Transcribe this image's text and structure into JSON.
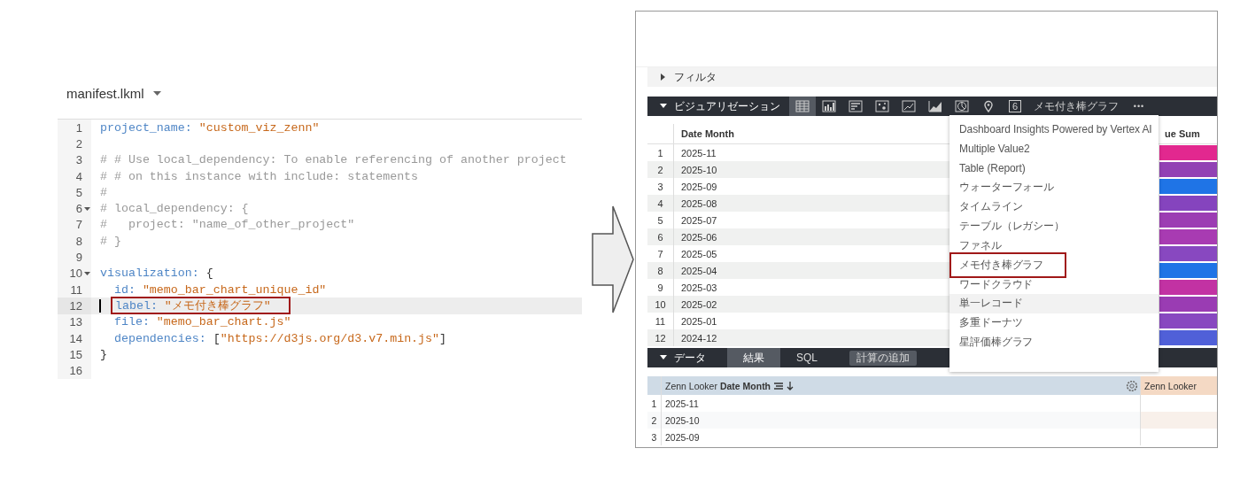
{
  "editor": {
    "file_name": "manifest.lkml",
    "lines": [
      {
        "number": "1",
        "fold": false,
        "current": false,
        "marked": false,
        "tokens": [
          {
            "kind": "key",
            "text": "project_name:"
          },
          {
            "kind": "string",
            "text": " \"custom_viz_zenn\""
          }
        ]
      },
      {
        "number": "2",
        "fold": false,
        "current": false,
        "marked": false
      },
      {
        "number": "3",
        "fold": false,
        "current": false,
        "marked": false,
        "tokens": [
          {
            "kind": "comment",
            "text": "# # Use local_dependency: To enable referencing of another project"
          }
        ]
      },
      {
        "number": "4",
        "fold": false,
        "current": false,
        "marked": false,
        "tokens": [
          {
            "kind": "comment",
            "text": "# # on this instance with include: statements"
          }
        ]
      },
      {
        "number": "5",
        "fold": false,
        "current": false,
        "marked": false,
        "tokens": [
          {
            "kind": "comment",
            "text": "#"
          }
        ]
      },
      {
        "number": "6",
        "fold": true,
        "current": false,
        "marked": false,
        "tokens": [
          {
            "kind": "comment",
            "text": "# local_dependency: {"
          }
        ]
      },
      {
        "number": "7",
        "fold": false,
        "current": false,
        "marked": false,
        "tokens": [
          {
            "kind": "comment",
            "text": "#   project: \"name_of_other_project\""
          }
        ]
      },
      {
        "number": "8",
        "fold": false,
        "current": false,
        "marked": false,
        "tokens": [
          {
            "kind": "comment",
            "text": "# }"
          }
        ]
      },
      {
        "number": "9",
        "fold": false,
        "current": false,
        "marked": false
      },
      {
        "number": "10",
        "fold": true,
        "current": false,
        "marked": false,
        "tokens": [
          {
            "kind": "key",
            "text": "visualization:"
          },
          {
            "kind": "plain",
            "text": " {"
          }
        ]
      },
      {
        "number": "11",
        "fold": false,
        "current": false,
        "marked": false,
        "tokens": [
          {
            "kind": "key",
            "text": "  id:"
          },
          {
            "kind": "string",
            "text": " \"memo_bar_chart_unique_id\""
          }
        ]
      },
      {
        "number": "12",
        "fold": false,
        "current": true,
        "marked": true,
        "tokens": [
          {
            "kind": "key",
            "text": "label:"
          },
          {
            "kind": "string",
            "text": " \"メモ付き棒グラフ\""
          }
        ]
      },
      {
        "number": "13",
        "fold": false,
        "current": false,
        "marked": false,
        "tokens": [
          {
            "kind": "key",
            "text": "  file:"
          },
          {
            "kind": "string",
            "text": " \"memo_bar_chart.js\""
          }
        ]
      },
      {
        "number": "14",
        "fold": false,
        "current": false,
        "marked": false,
        "tokens": [
          {
            "kind": "key",
            "text": "  dependencies:"
          },
          {
            "kind": "plain",
            "text": " ["
          },
          {
            "kind": "string",
            "text": "\"https://d3js.org/d3.v7.min.js\""
          },
          {
            "kind": "plain",
            "text": "]"
          }
        ]
      },
      {
        "number": "15",
        "fold": false,
        "current": false,
        "marked": false,
        "tokens": [
          {
            "kind": "plain",
            "text": "}"
          }
        ]
      },
      {
        "number": "16",
        "fold": false,
        "current": false,
        "marked": false
      }
    ]
  },
  "explore": {
    "filter": {
      "label": "フィルタ",
      "expanded": false
    },
    "visualization": {
      "label": "ビジュアリゼーション",
      "expanded": true,
      "types": [
        {
          "kind": "table",
          "selected": true
        },
        {
          "kind": "column",
          "selected": false
        },
        {
          "kind": "bar",
          "selected": false
        },
        {
          "kind": "scatter",
          "selected": false
        },
        {
          "kind": "line",
          "selected": false
        },
        {
          "kind": "area",
          "selected": false
        },
        {
          "kind": "pie",
          "selected": false
        },
        {
          "kind": "map",
          "selected": false
        },
        {
          "kind": "single",
          "text": "6",
          "selected": false
        },
        {
          "kind": "label",
          "text": "メモ付き棒グラフ",
          "selected": false
        },
        {
          "kind": "more",
          "text": "•••",
          "selected": false
        }
      ],
      "columns": [
        "Date Month",
        "ue Sum"
      ],
      "rows": [
        {
          "number": "1",
          "month": "2025-11",
          "color": "#e2288f"
        },
        {
          "number": "2",
          "month": "2025-10",
          "color": "#9241b4"
        },
        {
          "number": "3",
          "month": "2025-09",
          "color": "#1f74e6"
        },
        {
          "number": "4",
          "month": "2025-08",
          "color": "#8544be"
        },
        {
          "number": "5",
          "month": "2025-07",
          "color": "#9c3db3"
        },
        {
          "number": "6",
          "month": "2025-06",
          "color": "#a83bb2"
        },
        {
          "number": "7",
          "month": "2025-05",
          "color": "#8848c0"
        },
        {
          "number": "8",
          "month": "2025-04",
          "color": "#1f74e6"
        },
        {
          "number": "9",
          "month": "2025-03",
          "color": "#c232a3"
        },
        {
          "number": "10",
          "month": "2025-02",
          "color": "#9a3cb3"
        },
        {
          "number": "11",
          "month": "2025-01",
          "color": "#8848c0"
        },
        {
          "number": "12",
          "month": "2024-12",
          "color": "#5060d8"
        }
      ]
    },
    "menu": [
      {
        "label": "Dashboard Insights Powered by Vertex AI",
        "hovered": false,
        "marked": false
      },
      {
        "label": "Multiple Value2",
        "hovered": false,
        "marked": false
      },
      {
        "label": "Table (Report)",
        "hovered": false,
        "marked": false
      },
      {
        "label": "ウォーターフォール",
        "hovered": false,
        "marked": false
      },
      {
        "label": "タイムライン",
        "hovered": false,
        "marked": false
      },
      {
        "label": "テーブル（レガシー）",
        "hovered": false,
        "marked": false
      },
      {
        "label": "ファネル",
        "hovered": false,
        "marked": false
      },
      {
        "label": "メモ付き棒グラフ",
        "hovered": false,
        "marked": true
      },
      {
        "label": "ワードクラウド",
        "hovered": false,
        "marked": false
      },
      {
        "label": "単一レコード",
        "hovered": true,
        "marked": false
      },
      {
        "label": "多重ドーナツ",
        "hovered": false,
        "marked": false
      },
      {
        "label": "星評価棒グラフ",
        "hovered": false,
        "marked": false
      }
    ],
    "data": {
      "label": "データ",
      "expanded": true,
      "tabs": [
        {
          "label": "結果",
          "selected": true
        },
        {
          "label": "SQL",
          "selected": false
        }
      ],
      "button": "計算の追加",
      "columns": [
        "Zenn Looker **Date Month**",
        "Zenn Looker"
      ],
      "rows": [
        {
          "number": "1",
          "month": "2025-11"
        },
        {
          "number": "2",
          "month": "2025-10"
        },
        {
          "number": "3",
          "month": "2025-09"
        }
      ]
    }
  }
}
